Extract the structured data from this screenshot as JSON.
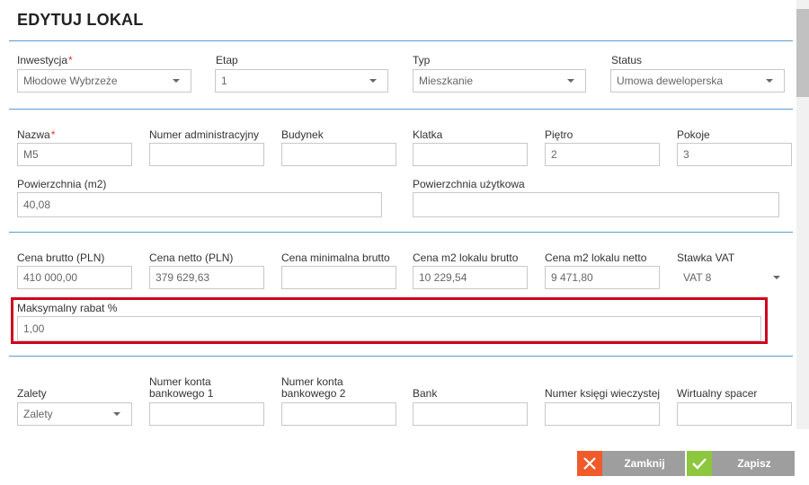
{
  "title": "EDYTUJ LOKAL",
  "row1": {
    "inwestycja": {
      "label": "Inwestycja",
      "required_mark": "*",
      "value": "Młodowe Wybrzeże"
    },
    "etap": {
      "label": "Etap",
      "value": "1"
    },
    "typ": {
      "label": "Typ",
      "value": "Mieszkanie"
    },
    "status": {
      "label": "Status",
      "value": "Umowa deweloperska"
    }
  },
  "row2": {
    "nazwa": {
      "label": "Nazwa",
      "required_mark": "*",
      "value": "M5"
    },
    "numer_admin": {
      "label": "Numer administracyjny",
      "value": ""
    },
    "budynek": {
      "label": "Budynek",
      "value": ""
    },
    "klatka": {
      "label": "Klatka",
      "value": ""
    },
    "pietro": {
      "label": "Piętro",
      "value": "2"
    },
    "pokoje": {
      "label": "Pokoje",
      "value": "3"
    }
  },
  "row3": {
    "powierzchnia": {
      "label": "Powierzchnia (m2)",
      "value": "40,08"
    },
    "powierzchnia_uzytkowa": {
      "label": "Powierzchnia użytkowa",
      "value": ""
    }
  },
  "row4": {
    "cena_brutto": {
      "label": "Cena brutto (PLN)",
      "value": "410 000,00"
    },
    "cena_netto": {
      "label": "Cena netto (PLN)",
      "value": "379 629,63"
    },
    "cena_min_brutto": {
      "label": "Cena minimalna brutto",
      "value": ""
    },
    "cena_m2_brutto": {
      "label": "Cena m2 lokalu brutto",
      "value": "10 229,54"
    },
    "cena_m2_netto": {
      "label": "Cena m2 lokalu netto",
      "value": "9 471,80"
    },
    "stawka_vat": {
      "label": "Stawka VAT",
      "value": "VAT 8"
    }
  },
  "row5": {
    "maks_rabat": {
      "label": "Maksymalny rabat %",
      "value": "1,00"
    }
  },
  "row6": {
    "zalety": {
      "label": "Zalety",
      "value": "Zalety"
    },
    "konto1": {
      "label_line1": "Numer konta",
      "label_line2": "bankowego 1",
      "value": ""
    },
    "konto2": {
      "label_line1": "Numer konta",
      "label_line2": "bankowego 2",
      "value": ""
    },
    "bank": {
      "label": "Bank",
      "value": ""
    },
    "ksiega": {
      "label": "Numer księgi wieczystej",
      "value": ""
    },
    "spacer": {
      "label": "Wirtualny spacer",
      "value": ""
    }
  },
  "buttons": {
    "close_label": "Zamknij",
    "save_label": "Zapisz"
  },
  "colors": {
    "divider": "#5b9bd5",
    "required": "#e53935",
    "highlight": "#d0001e",
    "close_icon_bg": "#f15a2b",
    "save_icon_bg": "#8dc63f",
    "button_bg": "#9e9e9e"
  },
  "icons": {
    "close": "close-icon",
    "save": "checkmark-icon",
    "dropdown": "chevron-down-icon"
  }
}
